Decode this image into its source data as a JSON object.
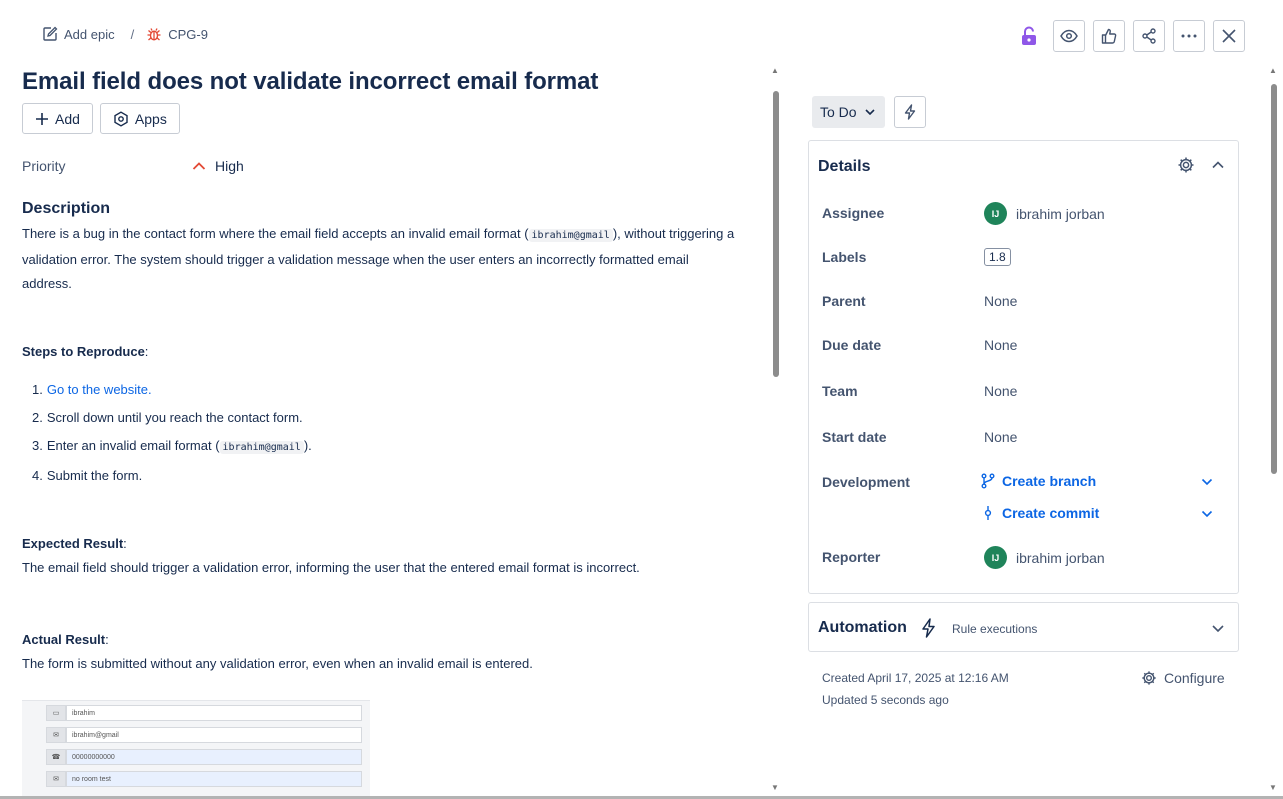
{
  "breadcrumb": {
    "add_epic": "Add epic",
    "separator": "/",
    "issue_key": "CPG-9"
  },
  "issue": {
    "title": "Email field does not validate incorrect email format",
    "add_label": "Add",
    "apps_label": "Apps",
    "priority_label": "Priority",
    "priority_value": "High",
    "description_heading": "Description",
    "description": {
      "part1": "There is a bug in the contact form where the email field accepts an invalid email format (",
      "code": "ibrahim@gmail",
      "part2": "), without triggering a validation error. The system should trigger a validation message when the user enters an incorrectly formatted email address."
    },
    "steps_heading": "Steps to Reproduce",
    "steps": [
      {
        "num": "1.",
        "text": "Go to the website."
      },
      {
        "num": "2.",
        "text": "Scroll down until you reach the contact form."
      },
      {
        "num": "3.",
        "text": "Enter an invalid email format (",
        "code": "ibrahim@gmail",
        "after": ")."
      },
      {
        "num": "4.",
        "text": "Submit the form."
      }
    ],
    "expected_heading": "Expected Result",
    "expected_text": "The email field should trigger a validation error, informing the user that the entered email format is incorrect.",
    "actual_heading": "Actual Result",
    "actual_text": "The form is submitted without any validation error, even when an invalid email is entered.",
    "attachment_fields": [
      "ibrahim",
      "ibrahim@gmail",
      "00000000000",
      "no room test"
    ]
  },
  "sidebar": {
    "status": "To Do",
    "details_title": "Details",
    "fields": {
      "assignee_label": "Assignee",
      "assignee_initials": "IJ",
      "assignee_name": "ibrahim jorban",
      "labels_label": "Labels",
      "labels_value": "1.8",
      "parent_label": "Parent",
      "parent_value": "None",
      "due_label": "Due date",
      "due_value": "None",
      "team_label": "Team",
      "team_value": "None",
      "start_label": "Start date",
      "start_value": "None",
      "dev_label": "Development",
      "create_branch": "Create branch",
      "create_commit": "Create commit",
      "reporter_label": "Reporter",
      "reporter_initials": "IJ",
      "reporter_name": "ibrahim jorban"
    },
    "automation_title": "Automation",
    "automation_sub": "Rule executions",
    "created": "Created April 17, 2025 at 12:16 AM",
    "updated": "Updated 5 seconds ago",
    "configure": "Configure"
  },
  "colors": {
    "accent": "#0c66e4",
    "lock": "#8f57e8",
    "bug": "#e34935",
    "priority_high": "#e34935",
    "avatar": "#1f845a"
  }
}
